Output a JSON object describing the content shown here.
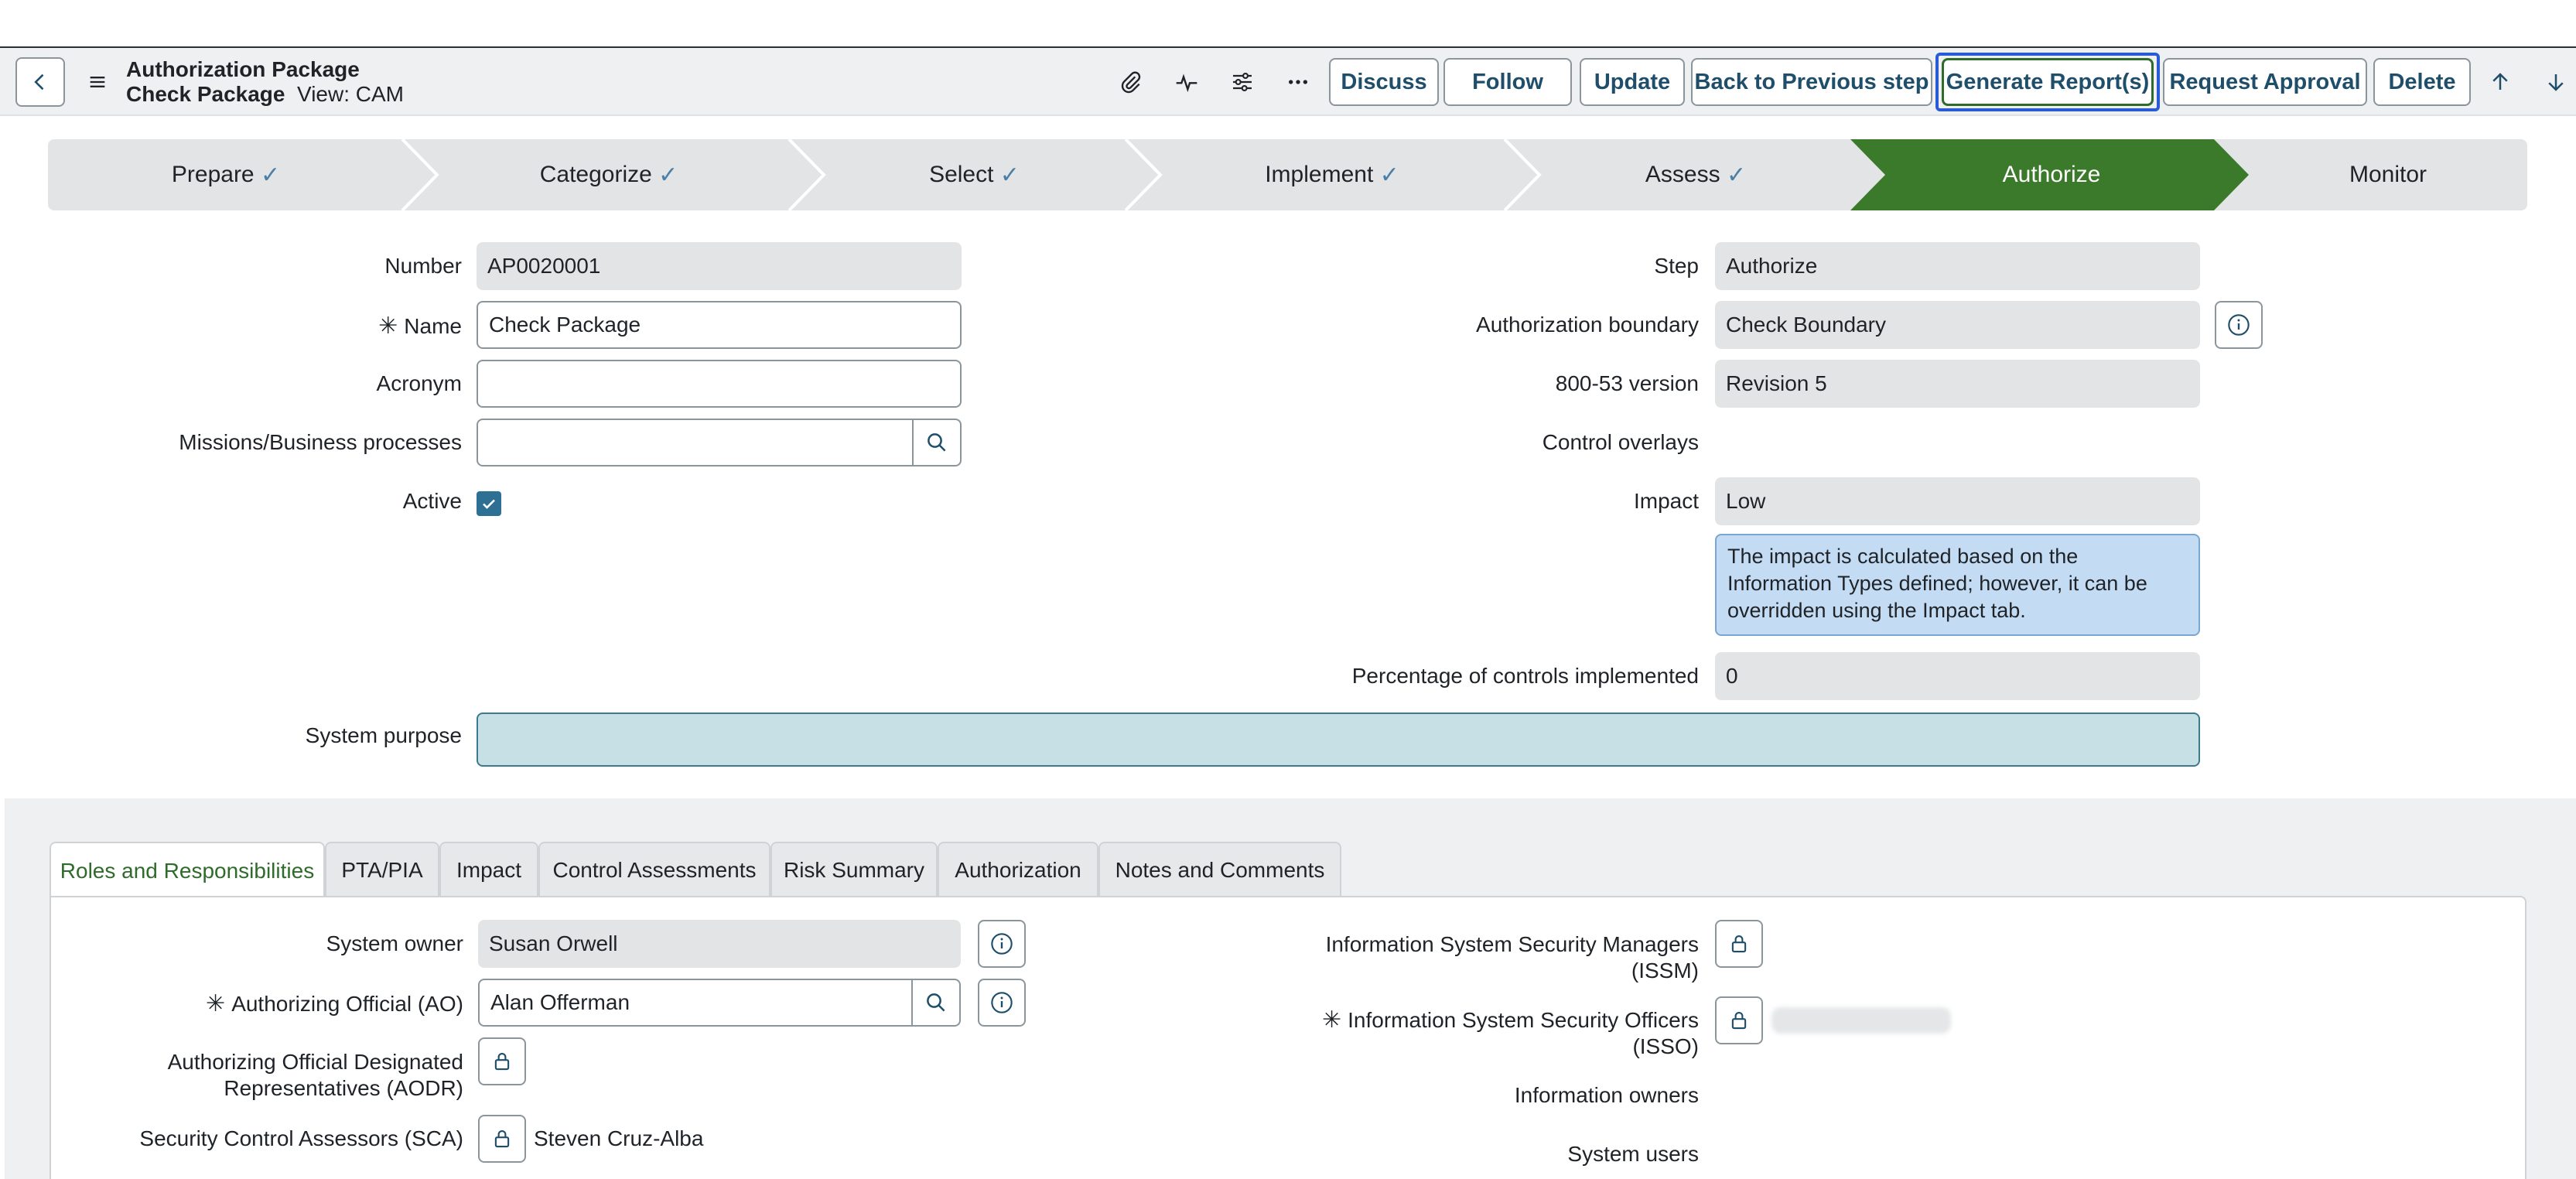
{
  "header": {
    "record_type": "Authorization Package",
    "record_name": "Check Package",
    "view_label": "View: CAM",
    "icons": [
      "back-icon",
      "menu-icon",
      "paperclip-icon",
      "activity-icon",
      "sliders-icon",
      "more-icon",
      "arrow-up-icon",
      "arrow-down-icon"
    ],
    "buttons": {
      "discuss": "Discuss",
      "follow": "Follow",
      "update": "Update",
      "back_prev": "Back to Previous step",
      "generate": "Generate Report(s)",
      "request_approval": "Request Approval",
      "delete": "Delete"
    }
  },
  "stepper": {
    "steps": [
      {
        "label": "Prepare",
        "done": true
      },
      {
        "label": "Categorize",
        "done": true
      },
      {
        "label": "Select",
        "done": true
      },
      {
        "label": "Implement",
        "done": true
      },
      {
        "label": "Assess",
        "done": true
      },
      {
        "label": "Authorize",
        "done": false,
        "active": true
      },
      {
        "label": "Monitor",
        "done": false
      }
    ],
    "check": "✓",
    "active_color": "#3b7a2a"
  },
  "form": {
    "number": {
      "label": "Number",
      "value": "AP0020001"
    },
    "name": {
      "label": "Name",
      "value": "Check Package",
      "required_mark": "✳"
    },
    "acronym": {
      "label": "Acronym",
      "value": ""
    },
    "missions": {
      "label": "Missions/Business processes",
      "value": ""
    },
    "active": {
      "label": "Active",
      "checked": true
    },
    "step": {
      "label": "Step",
      "value": "Authorize"
    },
    "boundary": {
      "label": "Authorization boundary",
      "value": "Check Boundary"
    },
    "version": {
      "label": "800-53 version",
      "value": "Revision 5"
    },
    "overlays": {
      "label": "Control overlays"
    },
    "impact": {
      "label": "Impact",
      "value": "Low",
      "note": "The impact is calculated based on the Information Types defined; however, it can be overridden using the Impact tab."
    },
    "percentage": {
      "label": "Percentage of controls implemented",
      "value": "0"
    },
    "purpose": {
      "label": "System purpose",
      "value": ""
    }
  },
  "tabs": [
    {
      "label": "Roles and Responsibilities",
      "active": true
    },
    {
      "label": "PTA/PIA"
    },
    {
      "label": "Impact"
    },
    {
      "label": "Control Assessments"
    },
    {
      "label": "Risk Summary"
    },
    {
      "label": "Authorization"
    },
    {
      "label": "Notes and Comments"
    }
  ],
  "roles": {
    "system_owner": {
      "label": "System owner",
      "value": "Susan Orwell"
    },
    "ao": {
      "label": "Authorizing Official (AO)",
      "value": "Alan Offerman",
      "required_mark": "✳"
    },
    "aodr": {
      "label_line1": "Authorizing Official Designated",
      "label_line2": "Representatives (AODR)"
    },
    "sca": {
      "label": "Security Control Assessors (SCA)",
      "value": "Steven Cruz-Alba"
    },
    "issm": {
      "label_line1": "Information System Security Managers",
      "label_line2": "(ISSM)"
    },
    "isso": {
      "label_line1": "Information System Security Officers",
      "label_line2": "(ISSO)",
      "required_mark": "✳"
    },
    "info_owners": {
      "label": "Information owners"
    },
    "system_users": {
      "label": "System users"
    }
  }
}
